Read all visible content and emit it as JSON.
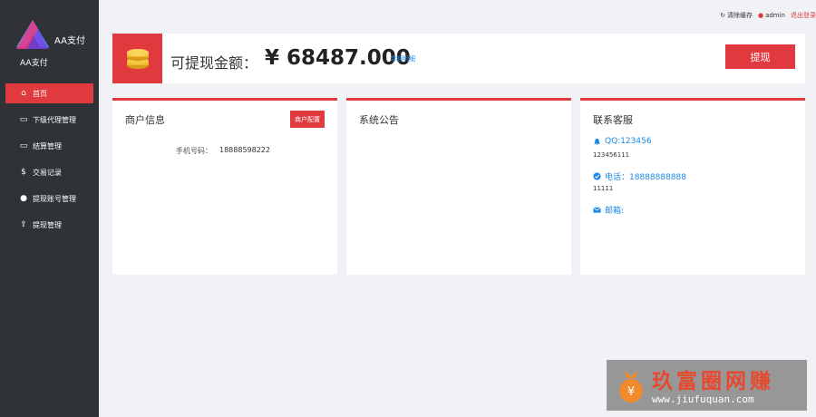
{
  "brand": {
    "title": "AA支付",
    "subtitle": "AA支付"
  },
  "sidebar": {
    "items": [
      {
        "label": "首页",
        "icon": "home-icon",
        "active": true
      },
      {
        "label": "下级代理管理",
        "icon": "card-icon",
        "active": false
      },
      {
        "label": "结算管理",
        "icon": "card-icon",
        "active": false
      },
      {
        "label": "交易记录",
        "icon": "dollar-icon",
        "active": false
      },
      {
        "label": "提现账号管理",
        "icon": "user-icon",
        "active": false
      },
      {
        "label": "提现管理",
        "icon": "upload-icon",
        "active": false
      }
    ]
  },
  "topbar": {
    "clear_cache": "清除缓存",
    "user": "admin",
    "logout": "退出登录"
  },
  "balance": {
    "label": "可提现金额：",
    "amount": "¥ 68487.000",
    "detail_link": "余额明细",
    "withdraw_button": "提现"
  },
  "merchant": {
    "title": "商户信息",
    "config_button": "商户配置",
    "phone_label": "手机号码：",
    "phone_value": "18888598222"
  },
  "notice": {
    "title": "系统公告"
  },
  "contact": {
    "title": "联系客服",
    "qq_label": "QQ:123456",
    "qq_sub": "123456111",
    "phone_label": "电话：18888888888",
    "phone_sub": "11111",
    "email_label": "邮箱:"
  },
  "watermark": {
    "title": "玖富圈网赚",
    "url": "www.jiufuquan.com"
  },
  "colors": {
    "accent": "#e0393e",
    "sidebar": "#2f3237",
    "link": "#1e88e5"
  }
}
